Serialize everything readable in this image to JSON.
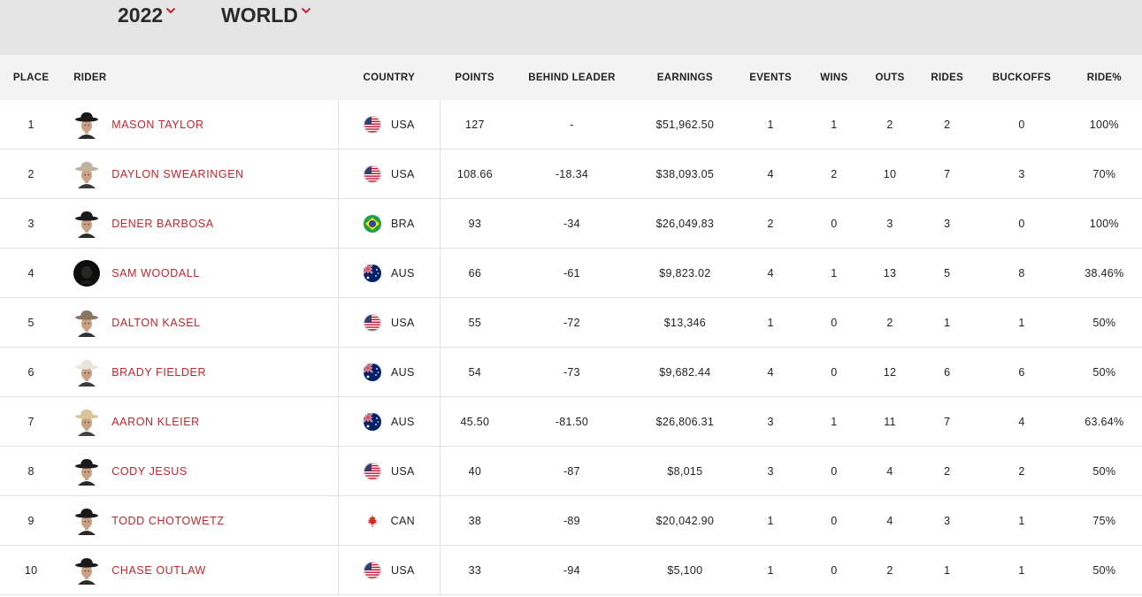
{
  "filters": {
    "year": "2022",
    "region": "WORLD"
  },
  "colors": {
    "accent": "#c4242b",
    "header_band": "#e5e5e5",
    "table_header": "#f3f3f3"
  },
  "table": {
    "headers": {
      "place": "PLACE",
      "rider": "RIDER",
      "country": "COUNTRY",
      "points": "POINTS",
      "behind": "BEHIND LEADER",
      "earnings": "EARNINGS",
      "events": "EVENTS",
      "wins": "WINS",
      "outs": "OUTS",
      "rides": "RIDES",
      "buckoffs": "BUCKOFFS",
      "ridepct": "RIDE%"
    },
    "rows": [
      {
        "place": "1",
        "rider": "MASON TAYLOR",
        "avatar": "cowboy-black-hat",
        "flag": "usa",
        "country": "USA",
        "points": "127",
        "behind": "-",
        "earnings": "$51,962.50",
        "events": "1",
        "wins": "1",
        "outs": "2",
        "rides": "2",
        "buckoffs": "0",
        "ridepct": "100%"
      },
      {
        "place": "2",
        "rider": "DAYLON SWEARINGEN",
        "avatar": "cowboy-light-hat",
        "flag": "usa",
        "country": "USA",
        "points": "108.66",
        "behind": "-18.34",
        "earnings": "$38,093.05",
        "events": "4",
        "wins": "2",
        "outs": "10",
        "rides": "7",
        "buckoffs": "3",
        "ridepct": "70%"
      },
      {
        "place": "3",
        "rider": "DENER BARBOSA",
        "avatar": "cowboy-black-hat",
        "flag": "brazil",
        "country": "BRA",
        "points": "93",
        "behind": "-34",
        "earnings": "$26,049.83",
        "events": "2",
        "wins": "0",
        "outs": "3",
        "rides": "3",
        "buckoffs": "0",
        "ridepct": "100%"
      },
      {
        "place": "4",
        "rider": "SAM WOODALL",
        "avatar": "dark-portrait",
        "flag": "australia",
        "country": "AUS",
        "points": "66",
        "behind": "-61",
        "earnings": "$9,823.02",
        "events": "4",
        "wins": "1",
        "outs": "13",
        "rides": "5",
        "buckoffs": "8",
        "ridepct": "38.46%"
      },
      {
        "place": "5",
        "rider": "DALTON KASEL",
        "avatar": "cowboy-brown-hat",
        "flag": "usa",
        "country": "USA",
        "points": "55",
        "behind": "-72",
        "earnings": "$13,346",
        "events": "1",
        "wins": "0",
        "outs": "2",
        "rides": "1",
        "buckoffs": "1",
        "ridepct": "50%"
      },
      {
        "place": "6",
        "rider": "BRADY FIELDER",
        "avatar": "cowboy-white-hat",
        "flag": "australia",
        "country": "AUS",
        "points": "54",
        "behind": "-73",
        "earnings": "$9,682.44",
        "events": "4",
        "wins": "0",
        "outs": "12",
        "rides": "6",
        "buckoffs": "6",
        "ridepct": "50%"
      },
      {
        "place": "7",
        "rider": "AARON KLEIER",
        "avatar": "cowboy-straw-hat",
        "flag": "australia",
        "country": "AUS",
        "points": "45.50",
        "behind": "-81.50",
        "earnings": "$26,806.31",
        "events": "3",
        "wins": "1",
        "outs": "11",
        "rides": "7",
        "buckoffs": "4",
        "ridepct": "63.64%"
      },
      {
        "place": "8",
        "rider": "CODY JESUS",
        "avatar": "cowboy-black-hat",
        "flag": "usa",
        "country": "USA",
        "points": "40",
        "behind": "-87",
        "earnings": "$8,015",
        "events": "3",
        "wins": "0",
        "outs": "4",
        "rides": "2",
        "buckoffs": "2",
        "ridepct": "50%"
      },
      {
        "place": "9",
        "rider": "TODD CHOTOWETZ",
        "avatar": "cowboy-black-hat",
        "flag": "canada",
        "country": "CAN",
        "points": "38",
        "behind": "-89",
        "earnings": "$20,042.90",
        "events": "1",
        "wins": "0",
        "outs": "4",
        "rides": "3",
        "buckoffs": "1",
        "ridepct": "75%"
      },
      {
        "place": "10",
        "rider": "CHASE OUTLAW",
        "avatar": "cowboy-black-hat",
        "flag": "usa",
        "country": "USA",
        "points": "33",
        "behind": "-94",
        "earnings": "$5,100",
        "events": "1",
        "wins": "0",
        "outs": "2",
        "rides": "1",
        "buckoffs": "1",
        "ridepct": "50%"
      }
    ]
  }
}
